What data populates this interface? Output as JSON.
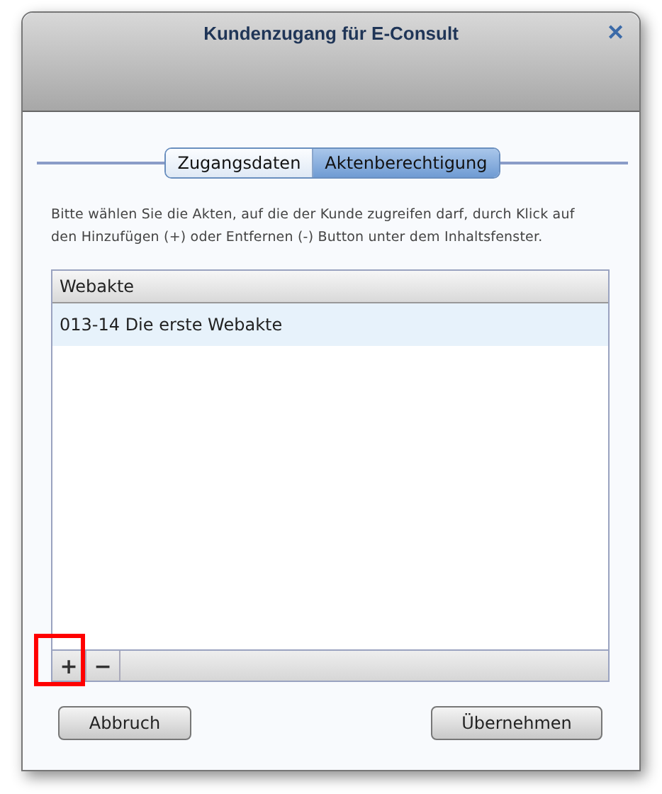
{
  "window": {
    "title": "Kundenzugang für E-Consult",
    "close": "✕"
  },
  "tabs": [
    {
      "label": "Zugangsdaten",
      "selected": false
    },
    {
      "label": "Aktenberechtigung",
      "selected": true
    }
  ],
  "instructions": "Bitte wählen Sie die Akten, auf die der Kunde zugreifen darf, durch Klick auf den Hinzufügen (+) oder Entfernen (-) Button unter dem Inhaltsfenster.",
  "table": {
    "columns": [
      "Webakte"
    ],
    "rows": [
      {
        "cells": [
          "013-14 Die erste Webakte"
        ],
        "selected": true
      }
    ]
  },
  "toolbar": [
    {
      "label": "+",
      "highlighted": true
    },
    {
      "label": "−",
      "highlighted": false
    }
  ],
  "buttons": [
    "Abbruch",
    "Übernehmen"
  ]
}
